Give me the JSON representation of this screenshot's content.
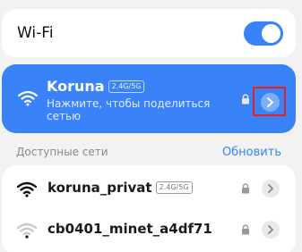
{
  "wifi": {
    "title": "Wi-Fi",
    "enabled": true
  },
  "current_network": {
    "name": "Koruna",
    "band": "2.4G/5G",
    "subtitle": "Нажмите, чтобы поделиться сетью",
    "icon": "wifi-icon",
    "locked": true
  },
  "available": {
    "label": "Доступные сети",
    "refresh_label": "Обновить",
    "networks": [
      {
        "name": "koruna_privat",
        "band": "2.4G/5G",
        "locked": true,
        "signal": "strong"
      },
      {
        "name": "cb0401_minet_a4df71",
        "band": "",
        "locked": true,
        "signal": "weak"
      }
    ]
  },
  "colors": {
    "accent": "#3a82f7",
    "highlight_border": "#e5231b",
    "background": "#f2f2f2"
  }
}
